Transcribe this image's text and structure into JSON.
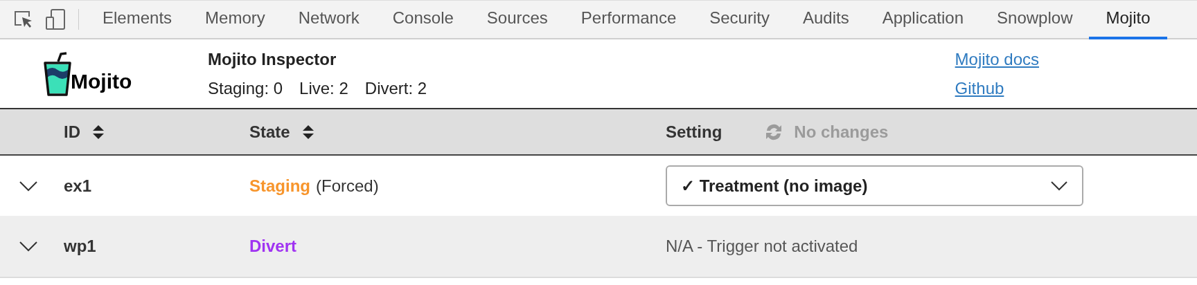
{
  "tabs": [
    {
      "label": "Elements",
      "selected": false
    },
    {
      "label": "Memory",
      "selected": false
    },
    {
      "label": "Network",
      "selected": false
    },
    {
      "label": "Console",
      "selected": false
    },
    {
      "label": "Sources",
      "selected": false
    },
    {
      "label": "Performance",
      "selected": false
    },
    {
      "label": "Security",
      "selected": false
    },
    {
      "label": "Audits",
      "selected": false
    },
    {
      "label": "Application",
      "selected": false
    },
    {
      "label": "Snowplow",
      "selected": false
    },
    {
      "label": "Mojito",
      "selected": true
    }
  ],
  "header": {
    "logo_text": "Mojito",
    "title": "Mojito Inspector",
    "stats": [
      "Staging: 0",
      "Live: 2",
      "Divert: 2"
    ],
    "links": [
      "Mojito docs",
      "Github"
    ]
  },
  "table": {
    "columns": [
      {
        "label": "ID",
        "sortable": true
      },
      {
        "label": "State",
        "sortable": true
      },
      {
        "label": "Setting",
        "sortable": false
      }
    ],
    "status": {
      "label": "No changes",
      "disabled": true
    },
    "rows": [
      {
        "id": "ex1",
        "state": "Staging",
        "color": "#f7952c",
        "note": "(Forced)",
        "setting": {
          "kind": "select",
          "value": "✓ Treatment (no image)"
        }
      },
      {
        "id": "wp1",
        "state": "Divert",
        "color": "#a033f2",
        "setting": {
          "kind": "text",
          "value": "N/A - Trigger not activated"
        }
      }
    ]
  }
}
